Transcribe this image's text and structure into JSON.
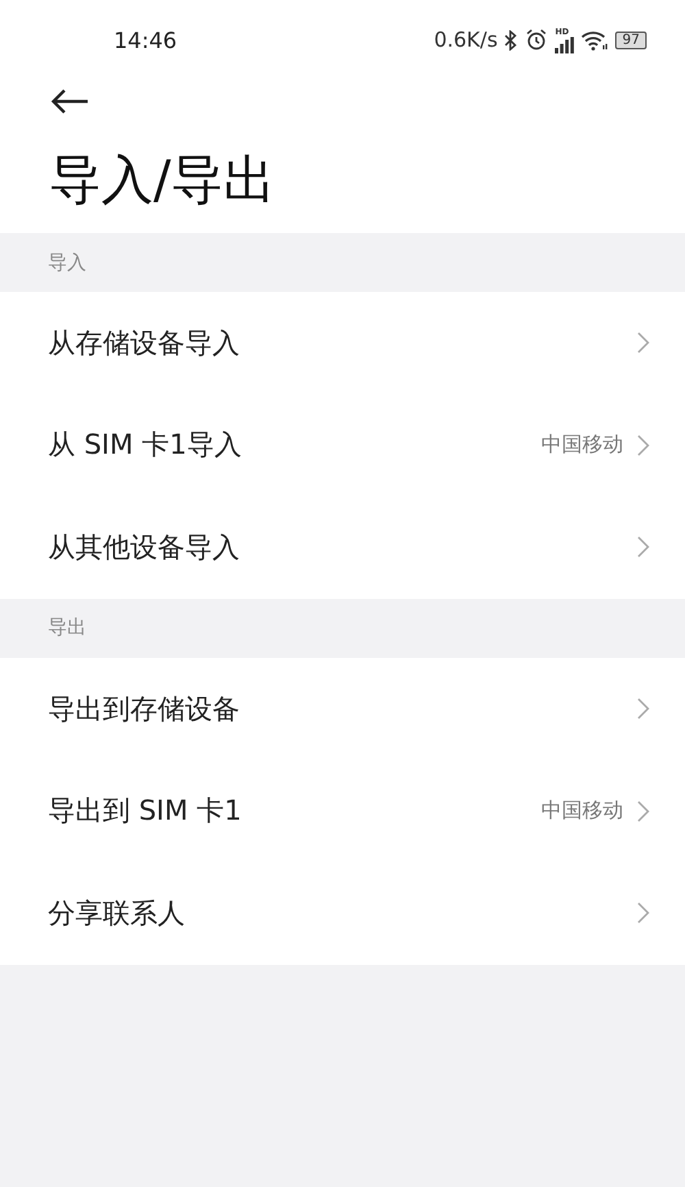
{
  "status_bar": {
    "time": "14:46",
    "speed": "0.6K/s",
    "signal_label": "HD",
    "battery": "97"
  },
  "title": "导入/导出",
  "sections": [
    {
      "header": "导入",
      "items": [
        {
          "label": "从存储设备导入"
        },
        {
          "label": "从 SIM 卡1导入",
          "value": "中国移动"
        },
        {
          "label": "从其他设备导入"
        }
      ]
    },
    {
      "header": "导出",
      "items": [
        {
          "label": "导出到存储设备"
        },
        {
          "label": "导出到 SIM 卡1",
          "value": "中国移动"
        },
        {
          "label": "分享联系人"
        }
      ]
    }
  ]
}
